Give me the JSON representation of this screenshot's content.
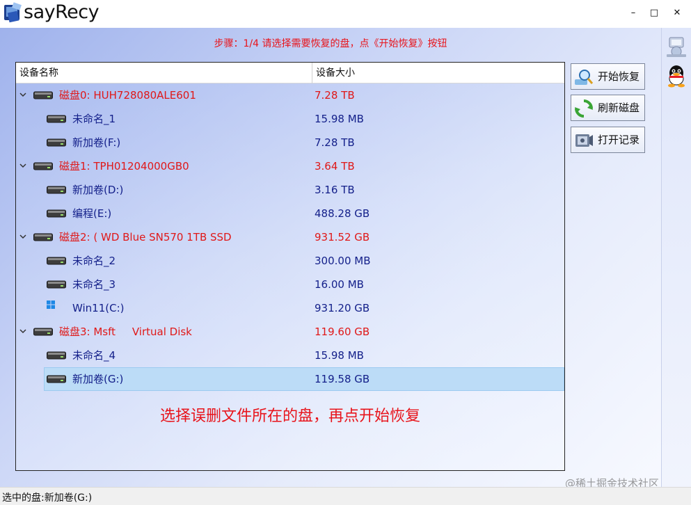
{
  "app": {
    "title": "sayRecy"
  },
  "window_controls": {
    "minimize": "–",
    "maximize": "□",
    "close": "✕"
  },
  "step": {
    "text": "步骤：1/4 请选择需要恢复的盘，点《开始恢复》按钮"
  },
  "table": {
    "columns": [
      "设备名称",
      "设备大小"
    ],
    "rows": [
      {
        "type": "disk",
        "name": "磁盘0: HUH728080ALE601",
        "size": "7.28 TB",
        "icon": "hard-drive-icon"
      },
      {
        "type": "part",
        "name": "未命名_1",
        "size": "15.98 MB",
        "icon": "drive-icon"
      },
      {
        "type": "part",
        "name": "新加卷(F:)",
        "size": "7.28 TB",
        "icon": "drive-icon"
      },
      {
        "type": "disk",
        "name": "磁盘1: TPH01204000GB0",
        "size": "3.64 TB",
        "icon": "hard-drive-icon"
      },
      {
        "type": "part",
        "name": "新加卷(D:)",
        "size": "3.16 TB",
        "icon": "drive-icon"
      },
      {
        "type": "part",
        "name": "编程(E:)",
        "size": "488.28 GB",
        "icon": "drive-icon"
      },
      {
        "type": "disk",
        "name": "磁盘2: ( WD Blue SN570 1TB SSD",
        "size": "931.52 GB",
        "icon": "hard-drive-icon"
      },
      {
        "type": "part",
        "name": "未命名_2",
        "size": "300.00 MB",
        "icon": "drive-icon"
      },
      {
        "type": "part",
        "name": "未命名_3",
        "size": "16.00 MB",
        "icon": "drive-icon"
      },
      {
        "type": "part",
        "name": "Win11(C:)",
        "size": "931.20 GB",
        "icon": "windows-icon"
      },
      {
        "type": "disk",
        "name": "磁盘3: Msft     Virtual Disk",
        "size": "119.60 GB",
        "icon": "hard-drive-icon"
      },
      {
        "type": "part",
        "name": "未命名_4",
        "size": "15.98 MB",
        "icon": "drive-icon"
      },
      {
        "type": "part",
        "name": "新加卷(G:)",
        "size": "119.58 GB",
        "icon": "drive-icon",
        "selected": true
      }
    ]
  },
  "hint": {
    "text": "选择误删文件所在的盘，再点开始恢复"
  },
  "buttons": {
    "start": "开始恢复",
    "refresh": "刷新磁盘",
    "open_log": "打开记录"
  },
  "status": {
    "text": "选中的盘:新加卷(G:)"
  },
  "watermark": {
    "text": "@稀土掘金技术社区"
  },
  "colors": {
    "disk_text": "#e01818",
    "partition_text": "#14208a",
    "selection": "#bcdcf7",
    "step_text": "#e8141b"
  }
}
